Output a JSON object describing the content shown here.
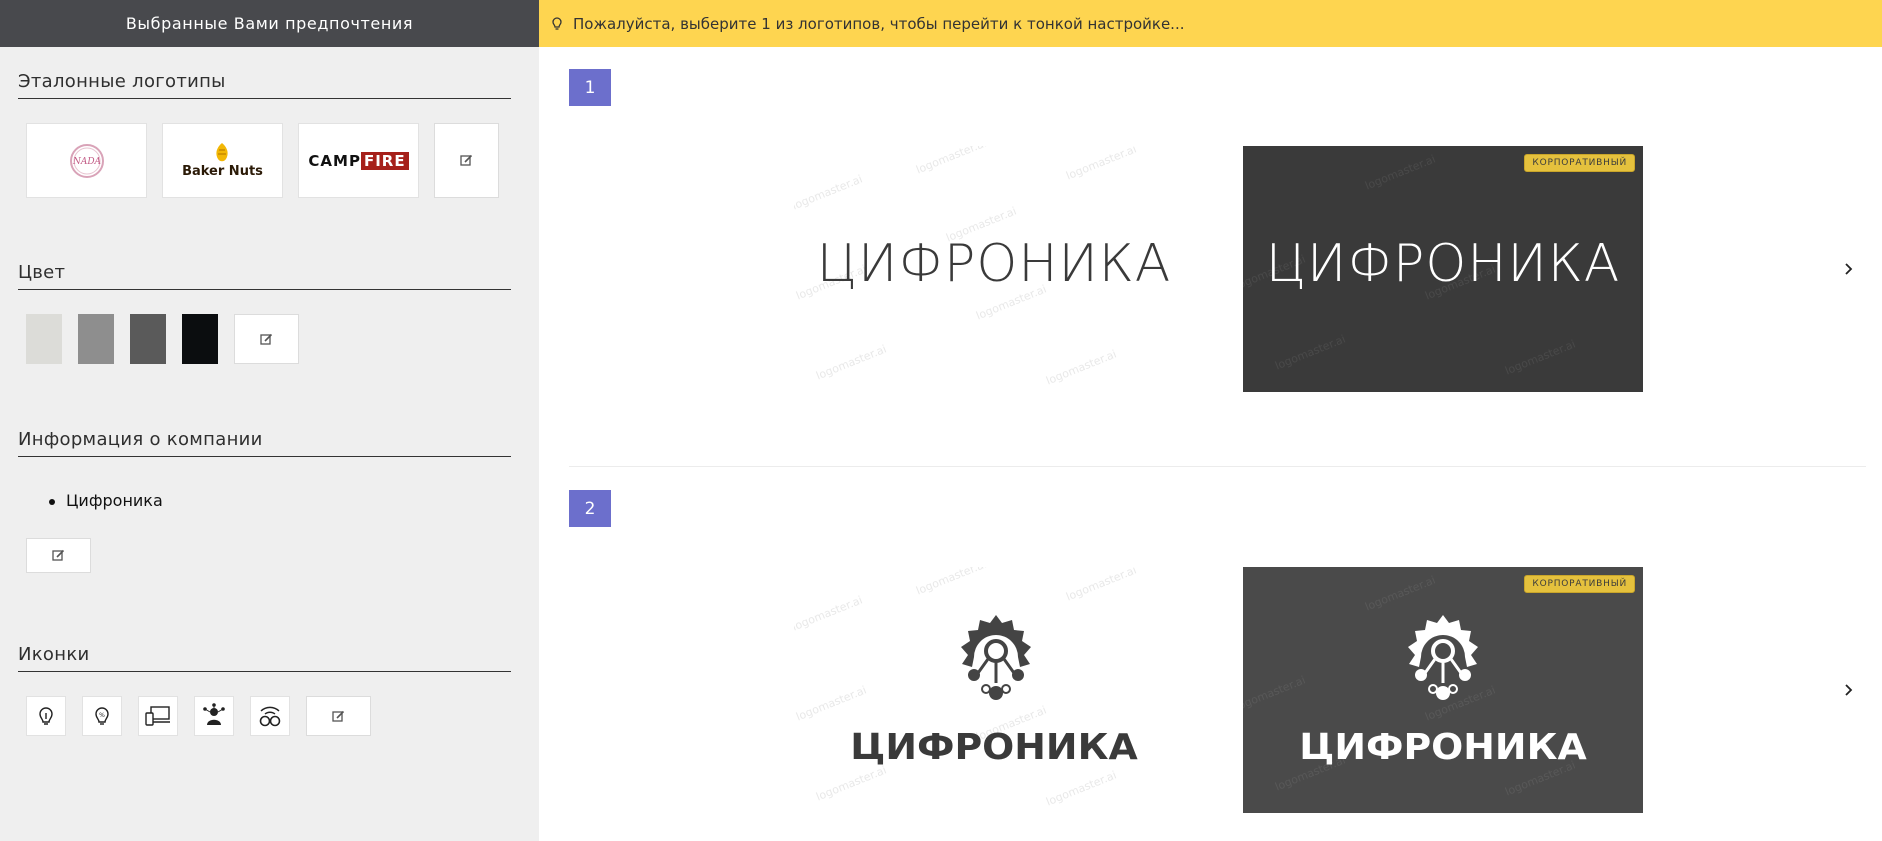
{
  "sidebar": {
    "header": "Выбранные Вами предпочтения",
    "sections": {
      "logos": {
        "title": "Эталонные логотипы",
        "items": [
          "Nada",
          "Baker Nuts",
          "CAMPFIRE"
        ]
      },
      "colors": {
        "title": "Цвет",
        "swatches": [
          "#dcdcd8",
          "#8e8e8e",
          "#5a5a5a",
          "#0b0d0f"
        ]
      },
      "company": {
        "title": "Информация о компании",
        "items": [
          "Цифроника"
        ]
      },
      "icons": {
        "title": "Иконки",
        "items": [
          "bulb-plug-icon",
          "bulb-percent-icon",
          "laptop-phone-icon",
          "network-person-icon",
          "wifi-glasses-icon"
        ]
      }
    },
    "logo_texts": {
      "nada": "NADA",
      "baker": "Baker Nuts",
      "camp": "CAMP",
      "fire": "FIRE"
    }
  },
  "notice": {
    "text": "Пожалуйста, выберите 1 из логотипов, чтобы перейти к тонкой настройке..."
  },
  "options": [
    {
      "number": "1",
      "brand": "ЦИФРОНИКА",
      "tag": "КОРПОРАТИВНЫЙ",
      "style": "thin"
    },
    {
      "number": "2",
      "brand": "ЦИФРОНИКА",
      "tag": "КОРПОРАТИВНЫЙ",
      "style": "bold-gear"
    }
  ],
  "watermark": "logomaster.ai",
  "colors": {
    "accent": "#6c6fcc",
    "notice": "#fed550",
    "sidebar_header": "#48494d",
    "dark_preview": "#3a3a3a",
    "dark_preview_2": "#4a4a4a",
    "tag": "#e5c13d"
  }
}
